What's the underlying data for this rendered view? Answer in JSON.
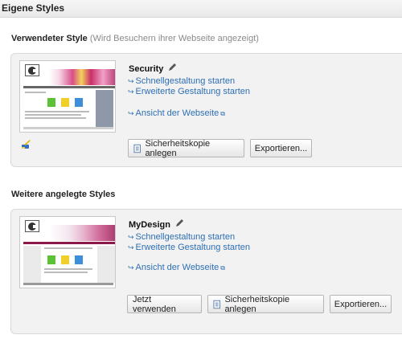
{
  "header": {
    "title": "Eigene Styles"
  },
  "current": {
    "heading": "Verwendeter Style",
    "hint": "(Wird Besuchern ihrer Webseite angezeigt)",
    "style_name": "Security",
    "link_quick": "Schnellgestaltung starten",
    "link_advanced": "Erweiterte Gestaltung starten",
    "link_view": "Ansicht der Webseite",
    "btn_backup": "Sicherheitskopie anlegen",
    "btn_export": "Exportieren..."
  },
  "others": {
    "heading": "Weitere angelegte Styles",
    "style_name": "MyDesign",
    "link_quick": "Schnellgestaltung starten",
    "link_advanced": "Erweiterte Gestaltung starten",
    "link_view": "Ansicht der Webseite",
    "btn_use": "Jetzt verwenden",
    "btn_backup": "Sicherheitskopie anlegen",
    "btn_export": "Exportieren..."
  },
  "icons": {
    "pencil": "pencil-icon",
    "link_arrow": "arrow-right-icon",
    "external": "external-link-icon",
    "brush": "paint-brush-icon",
    "document": "document-icon"
  },
  "colors": {
    "link": "#2e6fb4",
    "panel": "#f2f2f2"
  }
}
